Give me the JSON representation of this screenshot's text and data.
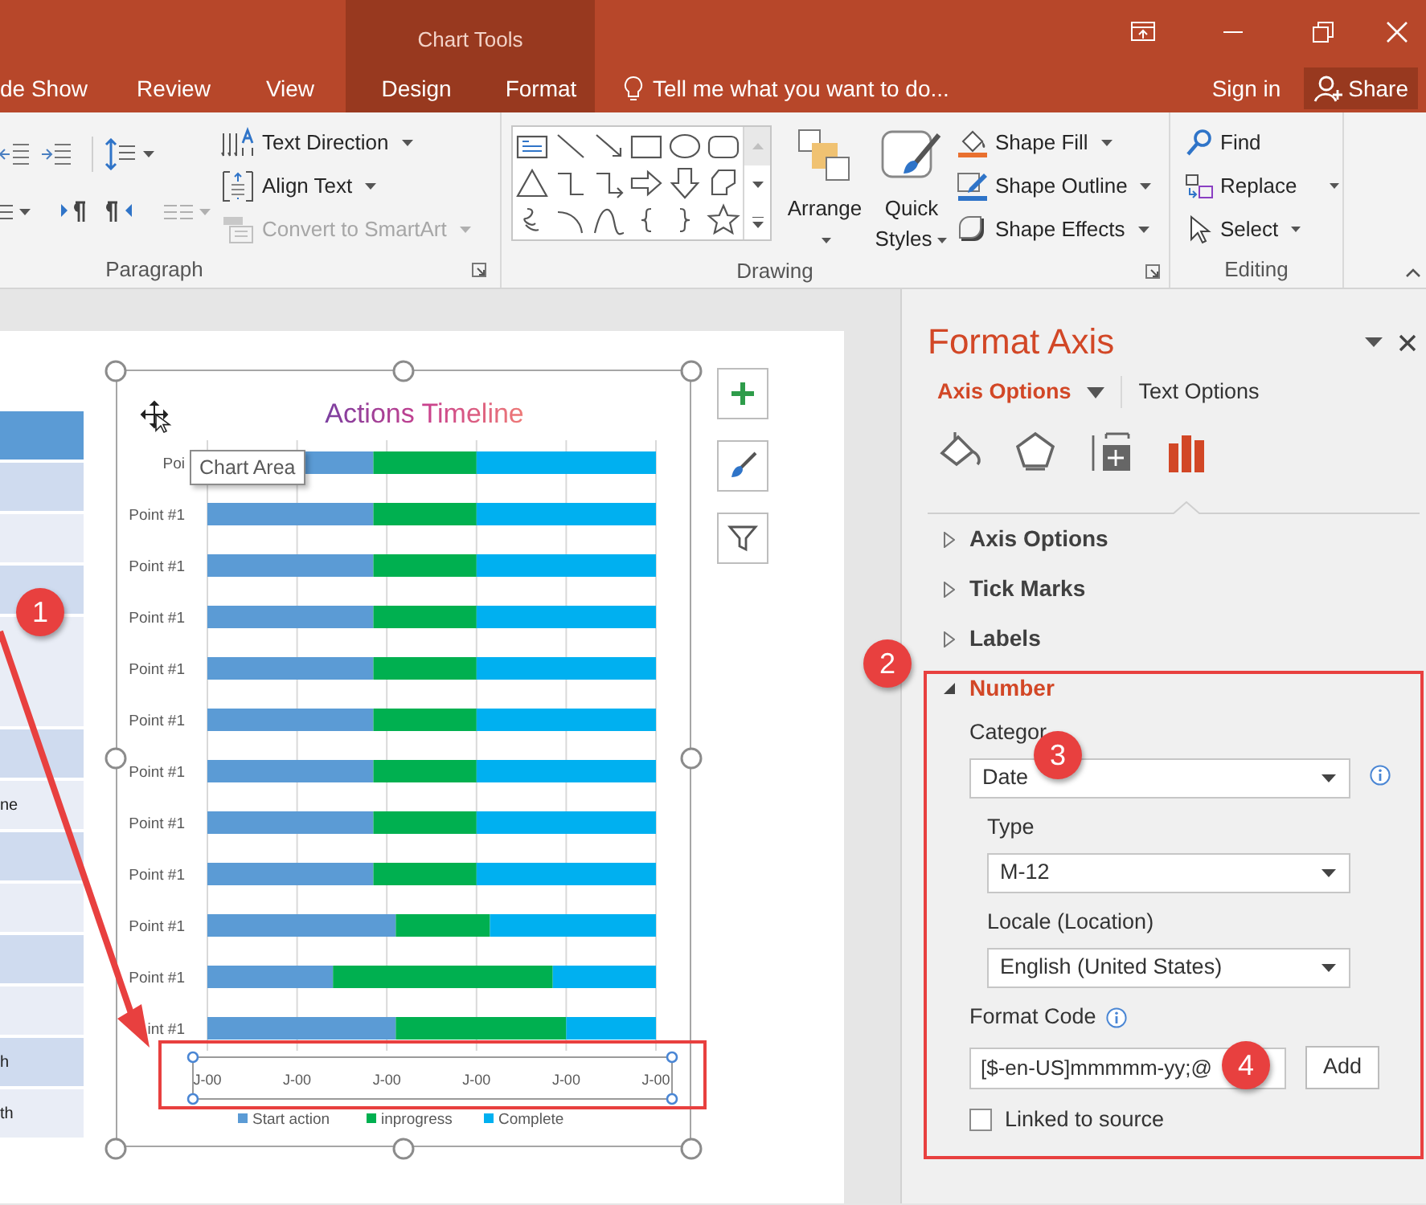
{
  "window": {
    "context_group": "Chart Tools"
  },
  "ribbon_tabs": [
    {
      "label": "de Show",
      "selected": false,
      "contextual": false
    },
    {
      "label": "Review",
      "selected": false,
      "contextual": false
    },
    {
      "label": "View",
      "selected": false,
      "contextual": false
    },
    {
      "label": "Design",
      "selected": false,
      "contextual": true
    },
    {
      "label": "Format",
      "selected": false,
      "contextual": true
    }
  ],
  "tell_me": "Tell me what you want to do...",
  "sign_in": "Sign in",
  "share": "Share",
  "ribbon": {
    "paragraph": {
      "label": "Paragraph",
      "commands": [
        {
          "label": "Text Direction",
          "dropdown": true,
          "disabled": false
        },
        {
          "label": "Align Text",
          "dropdown": true,
          "disabled": false
        },
        {
          "label": "Convert to SmartArt",
          "dropdown": true,
          "disabled": true
        }
      ]
    },
    "drawing": {
      "label": "Drawing",
      "big_buttons": [
        {
          "label": "Arrange",
          "dropdown": true
        },
        {
          "label": "Quick Styles",
          "dropdown": true
        }
      ],
      "commands": [
        {
          "label": "Shape Fill",
          "dropdown": true,
          "disabled": false
        },
        {
          "label": "Shape Outline",
          "dropdown": true,
          "disabled": false
        },
        {
          "label": "Shape Effects",
          "dropdown": true,
          "disabled": false
        }
      ]
    },
    "editing": {
      "label": "Editing",
      "commands": [
        {
          "label": "Find",
          "dropdown": false,
          "disabled": false
        },
        {
          "label": "Replace",
          "dropdown": true,
          "disabled": false
        },
        {
          "label": "Select",
          "dropdown": true,
          "disabled": false
        }
      ]
    }
  },
  "slide_table": {
    "rows": [
      {
        "kind": "header",
        "tall": false
      },
      {
        "kind": "dark",
        "tall": false
      },
      {
        "kind": "light",
        "tall": false
      },
      {
        "kind": "dark",
        "tall": false
      },
      {
        "kind": "light",
        "tall": true
      },
      {
        "kind": "dark",
        "tall": false
      },
      {
        "kind": "light",
        "tall": false,
        "text": "ne"
      },
      {
        "kind": "dark",
        "tall": false
      },
      {
        "kind": "light",
        "tall": false
      },
      {
        "kind": "dark",
        "tall": false
      },
      {
        "kind": "light",
        "tall": false
      },
      {
        "kind": "dark",
        "tall": false,
        "text": "h"
      },
      {
        "kind": "light",
        "tall": false,
        "text": "th"
      }
    ]
  },
  "chart": {
    "tooltip": "Chart Area",
    "title": "Actions Timeline",
    "categories": [
      "Poi",
      "Point #1",
      "Point #1",
      "Point #1",
      "Point #1",
      "Point #1",
      "Point #1",
      "Point #1",
      "Point #1",
      "Point #1",
      "Point #1",
      "int #1"
    ],
    "legend": [
      {
        "name": "Start action",
        "color": "#5b9bd5"
      },
      {
        "name": "inprogress",
        "color": "#00b050"
      },
      {
        "name": "Complete",
        "color": "#00b0f0"
      }
    ],
    "axis_tick_labels": [
      "J-00",
      "J-00",
      "J-00",
      "J-00",
      "J-00",
      "J-00"
    ]
  },
  "callouts": [
    {
      "label": "1"
    },
    {
      "label": "2"
    },
    {
      "label": "3"
    },
    {
      "label": "4"
    }
  ],
  "format_pane": {
    "title": "Format Axis",
    "tabs": [
      {
        "label": "Axis Options",
        "selected": true
      },
      {
        "label": "Text Options",
        "selected": false
      }
    ],
    "icon_tabs": [
      {
        "kind": "fill",
        "selected": false
      },
      {
        "kind": "effects",
        "selected": false
      },
      {
        "kind": "size",
        "selected": false
      },
      {
        "kind": "axis",
        "selected": true
      }
    ],
    "sections": [
      {
        "label": "Axis Options",
        "expanded": false
      },
      {
        "label": "Tick Marks",
        "expanded": false
      },
      {
        "label": "Labels",
        "expanded": false
      },
      {
        "label": "Number",
        "expanded": true
      }
    ],
    "number": {
      "category_label": "Categor",
      "category": "Date",
      "type_label": "Type",
      "type": "M-12",
      "locale_label": "Locale (Location)",
      "locale": "English (United States)",
      "format_code_label": "Format Code",
      "format_code": "[$-en-US]mmmmm-yy;@",
      "add_button": "Add",
      "linked_to_source": {
        "label": "Linked to source",
        "checked": false
      }
    }
  }
}
